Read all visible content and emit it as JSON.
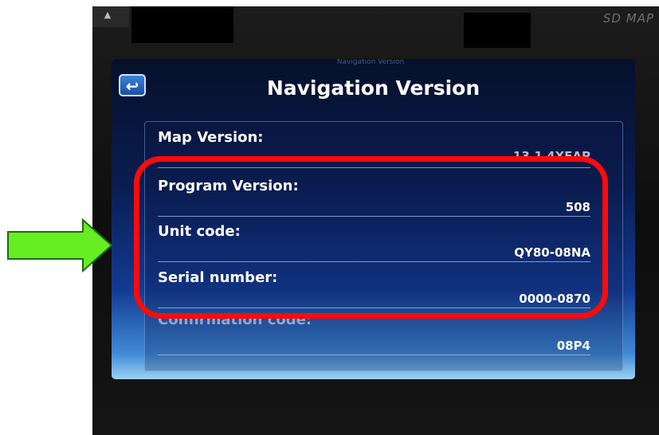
{
  "screen": {
    "title": "Navigation Version",
    "ghost_text": "Navigation Version",
    "back_icon": "back-arrow-icon",
    "brand": "SD MAP"
  },
  "rows": [
    {
      "label": "Map Version:",
      "value": "13.1 4XEAP"
    },
    {
      "label": "Program Version:",
      "value": "508"
    },
    {
      "label": "Unit code:",
      "value": "QY80-08NA"
    },
    {
      "label": "Serial number:",
      "value": "0000-0870"
    },
    {
      "label": "Confirmation code:",
      "value": "08P4"
    }
  ],
  "annotations": {
    "highlight_color": "#ff0a0a",
    "arrow_color": "#66ee22"
  }
}
